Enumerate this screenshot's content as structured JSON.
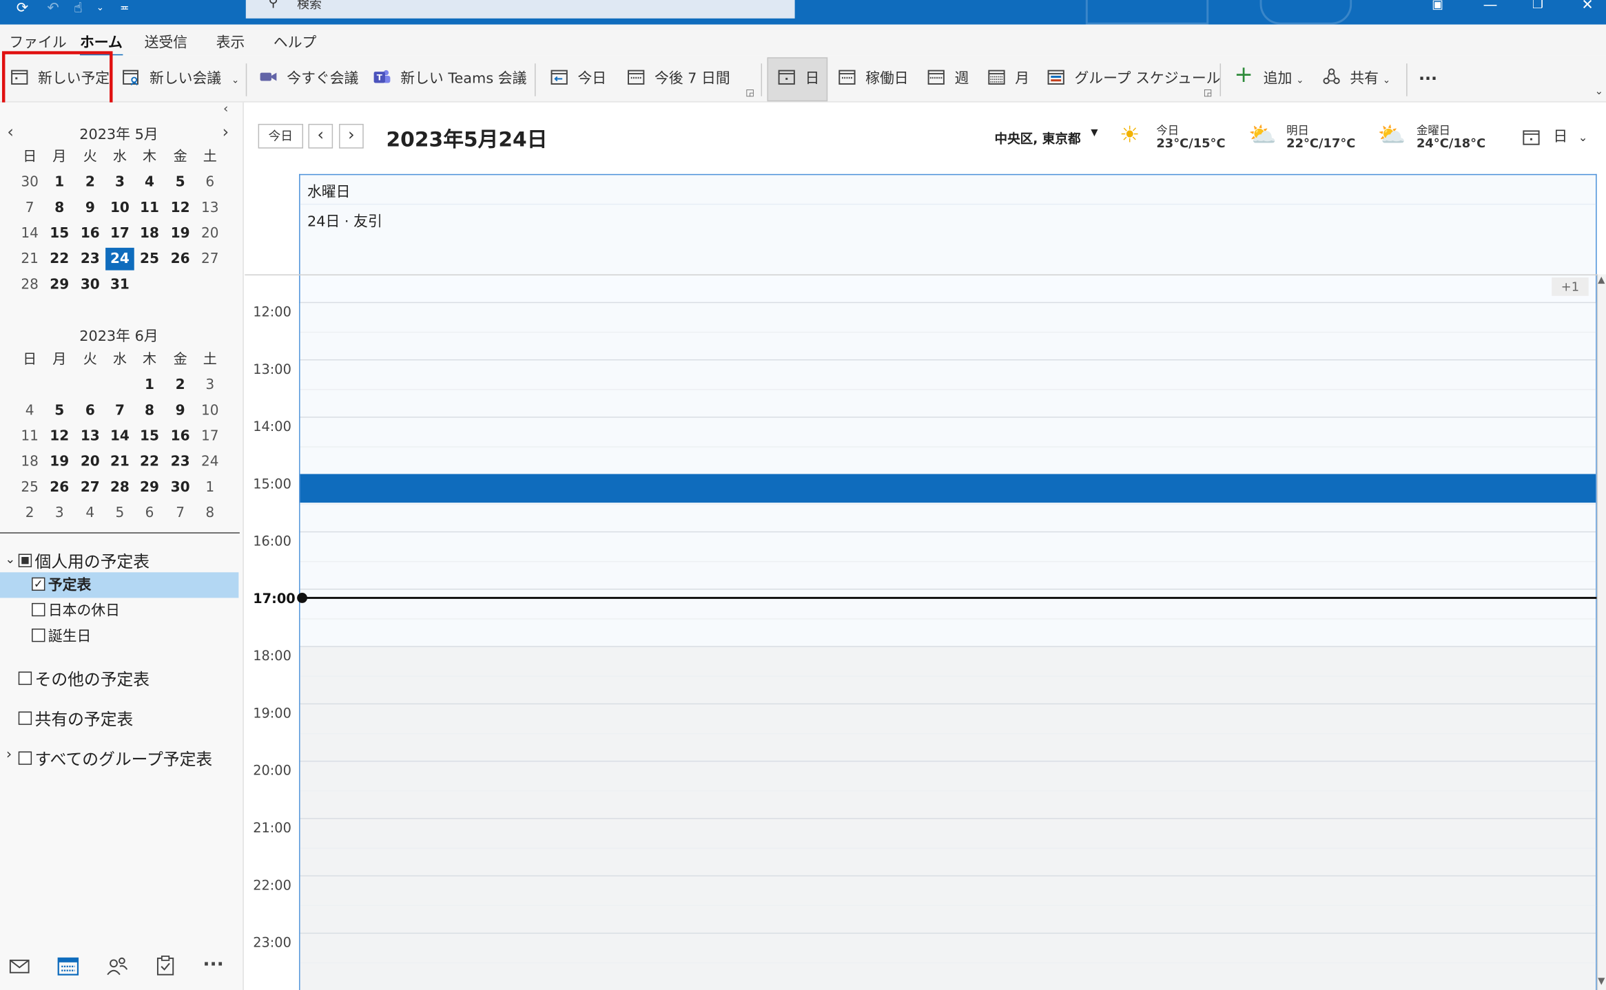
{
  "titlebar": {
    "search_placeholder": "検索",
    "icons": [
      "sync-icon",
      "undo-icon",
      "touch-mode-icon",
      "customize-qat-icon",
      "search-icon",
      "coming-soon-icon",
      "minimize-icon",
      "restore-icon",
      "close-icon"
    ]
  },
  "menu": {
    "items": [
      "ファイル",
      "ホーム",
      "送受信",
      "表示",
      "ヘルプ"
    ],
    "active": "ホーム"
  },
  "ribbon": {
    "new_appointment": "新しい予定",
    "new_meeting": "新しい会議",
    "meet_now": "今すぐ会議",
    "new_teams_meeting": "新しい Teams 会議",
    "today": "今日",
    "next7": "今後 7 日間",
    "day": "日",
    "work_week": "稼働日",
    "week": "週",
    "month": "月",
    "group_schedule": "グループ スケジュール",
    "add": "追加",
    "share": "共有",
    "more": "···"
  },
  "minical": {
    "weekday_headers": [
      "日",
      "月",
      "火",
      "水",
      "木",
      "金",
      "土"
    ],
    "months": [
      {
        "title": "2023年 5月",
        "rows": [
          [
            "30",
            "1",
            "2",
            "3",
            "4",
            "5",
            "6"
          ],
          [
            "7",
            "8",
            "9",
            "10",
            "11",
            "12",
            "13"
          ],
          [
            "14",
            "15",
            "16",
            "17",
            "18",
            "19",
            "20"
          ],
          [
            "21",
            "22",
            "23",
            "24",
            "25",
            "26",
            "27"
          ],
          [
            "28",
            "29",
            "30",
            "31",
            "",
            "",
            ""
          ]
        ],
        "today": "24"
      },
      {
        "title": "2023年 6月",
        "rows": [
          [
            "",
            "",
            "",
            "",
            "1",
            "2",
            "3"
          ],
          [
            "4",
            "5",
            "6",
            "7",
            "8",
            "9",
            "10"
          ],
          [
            "11",
            "12",
            "13",
            "14",
            "15",
            "16",
            "17"
          ],
          [
            "18",
            "19",
            "20",
            "21",
            "22",
            "23",
            "24"
          ],
          [
            "25",
            "26",
            "27",
            "28",
            "29",
            "30",
            "1"
          ],
          [
            "2",
            "3",
            "4",
            "5",
            "6",
            "7",
            "8"
          ]
        ]
      }
    ]
  },
  "calendars": {
    "group_personal": "個人用の予定表",
    "items": [
      "予定表",
      "日本の休日",
      "誕生日"
    ],
    "checked": "予定表",
    "other": "その他の予定表",
    "shared": "共有の予定表",
    "all_groups": "すべてのグループ予定表"
  },
  "bottom_nav": [
    "mail-icon",
    "calendar-icon",
    "people-icon",
    "tasks-icon",
    "more-icon"
  ],
  "main": {
    "today_button": "今日",
    "date_title": "2023年5月24日",
    "location": "中央区, 東京都",
    "weather": [
      {
        "day": "今日",
        "temp": "23°C/15°C",
        "icon": "sunny-icon"
      },
      {
        "day": "明日",
        "temp": "22°C/17°C",
        "icon": "partly-sunny-icon"
      },
      {
        "day": "金曜日",
        "temp": "24°C/18°C",
        "icon": "partly-sunny-icon"
      }
    ],
    "view_label": "日",
    "day_header": {
      "weekday": "水曜日",
      "date": "24日 · 友引"
    },
    "allday_more": "+1",
    "hours": [
      "12:00",
      "13:00",
      "14:00",
      "15:00",
      "16:00",
      "17:00",
      "18:00",
      "19:00",
      "20:00",
      "21:00",
      "22:00",
      "23:00"
    ],
    "current_hour": "17:00"
  },
  "colors": {
    "accent": "#0f6cbd",
    "highlight": "#e01010",
    "selected_row": "#b3d7f3"
  }
}
